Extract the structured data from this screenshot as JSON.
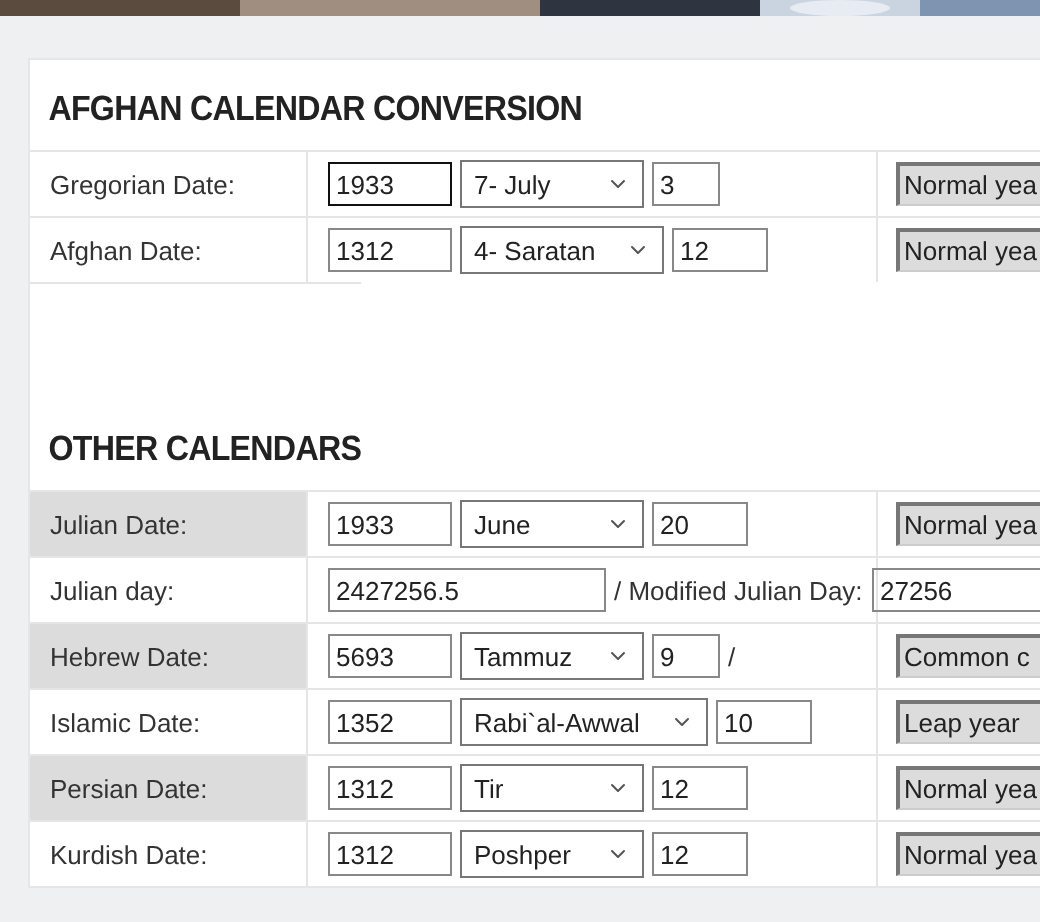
{
  "sections": [
    {
      "title": "AFGHAN CALENDAR CONVERSION",
      "rows": [
        {
          "kind": "date",
          "label": "Gregorian Date:",
          "shaded": false,
          "year": "1933",
          "focused": true,
          "month": "7- July",
          "day": "3",
          "status": "Normal yea"
        },
        {
          "kind": "date",
          "label": "Afghan Date:",
          "shaded": false,
          "year": "1312",
          "focused": false,
          "month": "4- Saratan",
          "day": "12",
          "status": "Normal yea"
        }
      ]
    },
    {
      "title": "OTHER CALENDARS",
      "rows": [
        {
          "kind": "date",
          "label": "Julian Date:",
          "shaded": true,
          "year": "1933",
          "focused": false,
          "month": "June",
          "day": "20",
          "status": "Normal yea"
        },
        {
          "kind": "jd",
          "label": "Julian day:",
          "shaded": false,
          "value": "2427256.5",
          "text": "/ Modified Julian Day:",
          "value2": "27256"
        },
        {
          "kind": "date",
          "label": "Hebrew Date:",
          "shaded": true,
          "year": "5693",
          "focused": false,
          "month": "Tammuz",
          "day": "9",
          "suffix": "/",
          "status": "Common c"
        },
        {
          "kind": "date",
          "label": "Islamic Date:",
          "shaded": false,
          "year": "1352",
          "focused": false,
          "month": "Rabi`al-Awwal",
          "day": "10",
          "status": "Leap year"
        },
        {
          "kind": "date",
          "label": "Persian Date:",
          "shaded": true,
          "year": "1312",
          "focused": false,
          "month": "Tir",
          "day": "12",
          "status": "Normal yea"
        },
        {
          "kind": "date",
          "label": "Kurdish Date:",
          "shaded": false,
          "year": "1312",
          "focused": false,
          "month": "Poshper",
          "day": "12",
          "status": "Normal yea"
        }
      ]
    }
  ]
}
